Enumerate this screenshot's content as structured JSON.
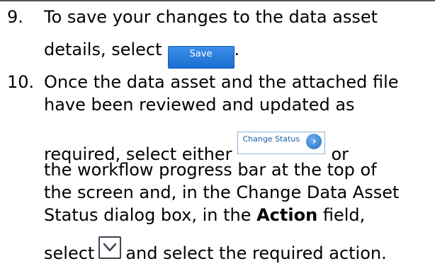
{
  "step9": {
    "number": "9.",
    "line1": "To save your changes to the data asset",
    "line2_prefix": "details, select",
    "save_button_label": "Save",
    "line2_suffix": "."
  },
  "step10": {
    "number": "10.",
    "line1": "Once the data asset and the attached file",
    "line2": "have been reviewed and updated as",
    "line3_prefix": "required, select either",
    "change_status_label": "Change Status",
    "line3_suffix": "or",
    "line4": "the workflow progress bar at the top of",
    "line5": "the screen and, in the Change Data Asset",
    "line6_prefix": "Status dialog box, in the",
    "line6_bold": "Action",
    "line6_suffix": "field,",
    "line7_prefix": "select",
    "line7_suffix": "and select the required action."
  },
  "icons": {
    "change_status_arrow": "arrow-right-circle-icon",
    "dropdown": "chevron-down-icon"
  },
  "colors": {
    "save_button": "#1a6ed1",
    "change_status_text": "#1a5fa8"
  }
}
